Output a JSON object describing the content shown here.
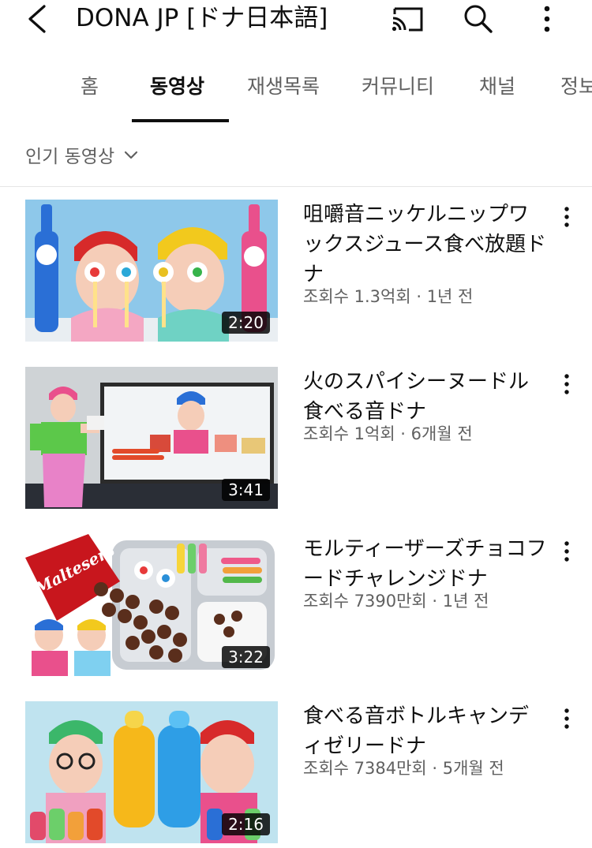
{
  "header": {
    "title": "DONA JP [ドナ日本語]",
    "icons": [
      "back-icon",
      "cast-icon",
      "search-icon",
      "more-vertical-icon"
    ]
  },
  "tabs": [
    {
      "label": "홈",
      "active": false
    },
    {
      "label": "동영상",
      "active": true
    },
    {
      "label": "재생목록",
      "active": false
    },
    {
      "label": "커뮤니티",
      "active": false
    },
    {
      "label": "채널",
      "active": false
    },
    {
      "label": "정보",
      "active": false
    }
  ],
  "sort": {
    "label": "인기 동영상"
  },
  "videos": [
    {
      "title": "咀嚼音ニッケルニップワックスジュース食べ放題ドナ",
      "meta": "조회수 1.3억회 · 1년 전",
      "duration": "2:20"
    },
    {
      "title": "火のスパイシーヌードル食べる音ドナ",
      "meta": "조회수 1억회 · 6개월 전",
      "duration": "3:41"
    },
    {
      "title": "モルティーザーズチョコフードチャレンジドナ",
      "meta": "조회수 7390만회 · 1년 전",
      "duration": "3:22"
    },
    {
      "title": "食べる音ボトルキャンディゼリードナ",
      "meta": "조회수 7384만회 · 5개월 전",
      "duration": "2:16"
    }
  ],
  "thumbnail_logo_text": "Maltesers",
  "colors": {
    "text": "#0f0f0f",
    "secondary": "#606060",
    "divider": "#e5e5e5"
  }
}
